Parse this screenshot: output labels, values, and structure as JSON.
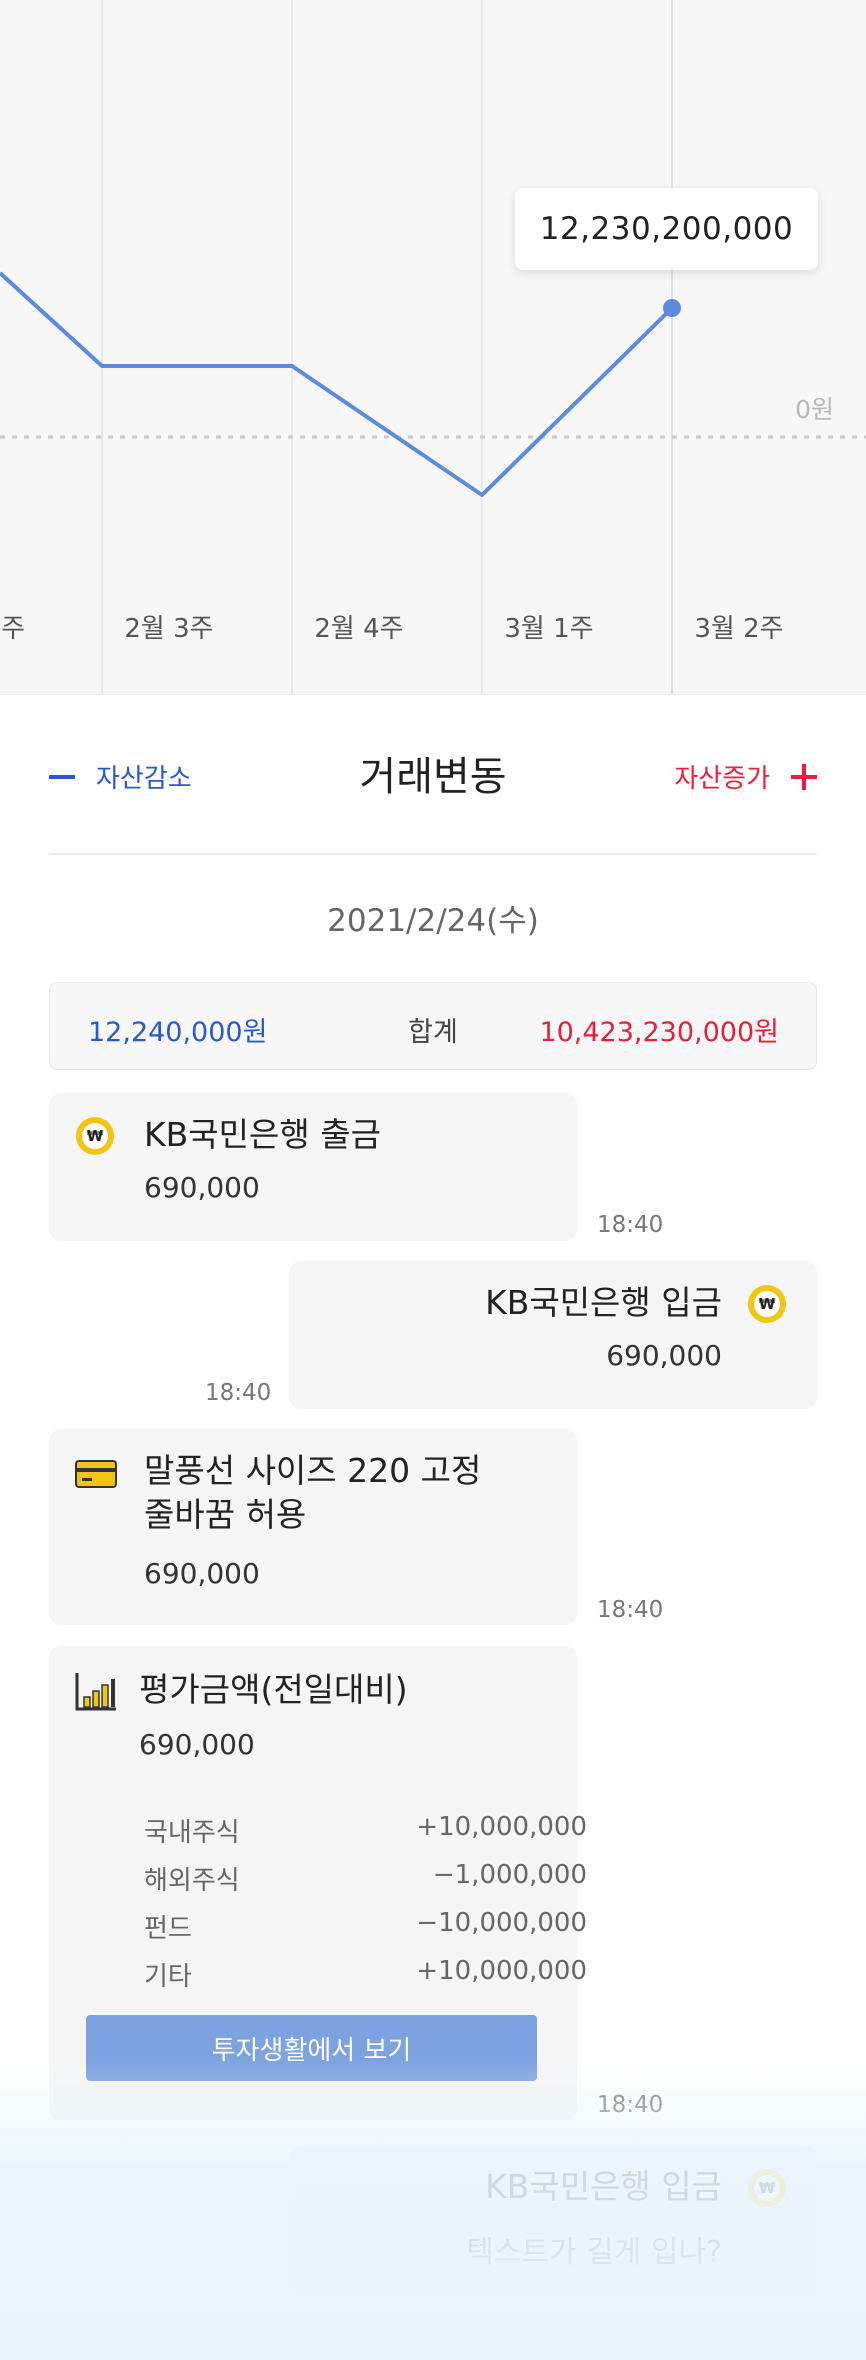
{
  "chart": {
    "tooltip_value": "12,230,200,000",
    "zero_label": "0원",
    "x_labels": [
      "주",
      "2월 3주",
      "2월 4주",
      "3월 1주",
      "3월 2주"
    ]
  },
  "chart_data": {
    "type": "line",
    "categories": [
      "주",
      "2월 3주",
      "2월 4주",
      "3월 1주",
      "3월 2주"
    ],
    "series": [
      {
        "values": [
          null,
          null,
          null,
          null,
          12230200000
        ]
      }
    ],
    "annotations": [
      "12,230,200,000",
      "0원"
    ]
  },
  "header": {
    "decrease_label": "자산감소",
    "title": "거래변동",
    "increase_label": "자산증가"
  },
  "date": "2021/2/24(수)",
  "summary": {
    "decrease_total": "12,240,000원",
    "label": "합계",
    "increase_total": "10,423,230,000원"
  },
  "transactions": [
    {
      "title": "KB국민은행 출금",
      "amount": "690,000",
      "time": "18:40",
      "icon": "won-coin-icon"
    },
    {
      "title": "KB국민은행 입금",
      "amount": "690,000",
      "time": "18:40",
      "icon": "won-coin-icon"
    },
    {
      "title_line1": "말풍선 사이즈 220 고정",
      "title_line2": "줄바꿈 허용",
      "amount": "690,000",
      "time": "18:40",
      "icon": "credit-card-icon"
    },
    {
      "title": "평가금액(전일대비)",
      "amount": "690,000",
      "time": "18:40",
      "icon": "bar-chart-icon",
      "details": [
        {
          "label": "국내주식",
          "value": "+10,000,000"
        },
        {
          "label": "해외주식",
          "value": "−1,000,000"
        },
        {
          "label": "펀드",
          "value": "−10,000,000"
        },
        {
          "label": "기타",
          "value": "+10,000,000"
        }
      ],
      "button": "투자생활에서 보기"
    },
    {
      "title": "KB국민은행 입금",
      "subtitle": "텍스트가 길게 입나?",
      "icon": "won-coin-icon"
    }
  ],
  "colors": {
    "decrease": "#2759c9",
    "increase": "#e81f3a",
    "line": "#5b8bdc",
    "coin": "#f2c414"
  }
}
